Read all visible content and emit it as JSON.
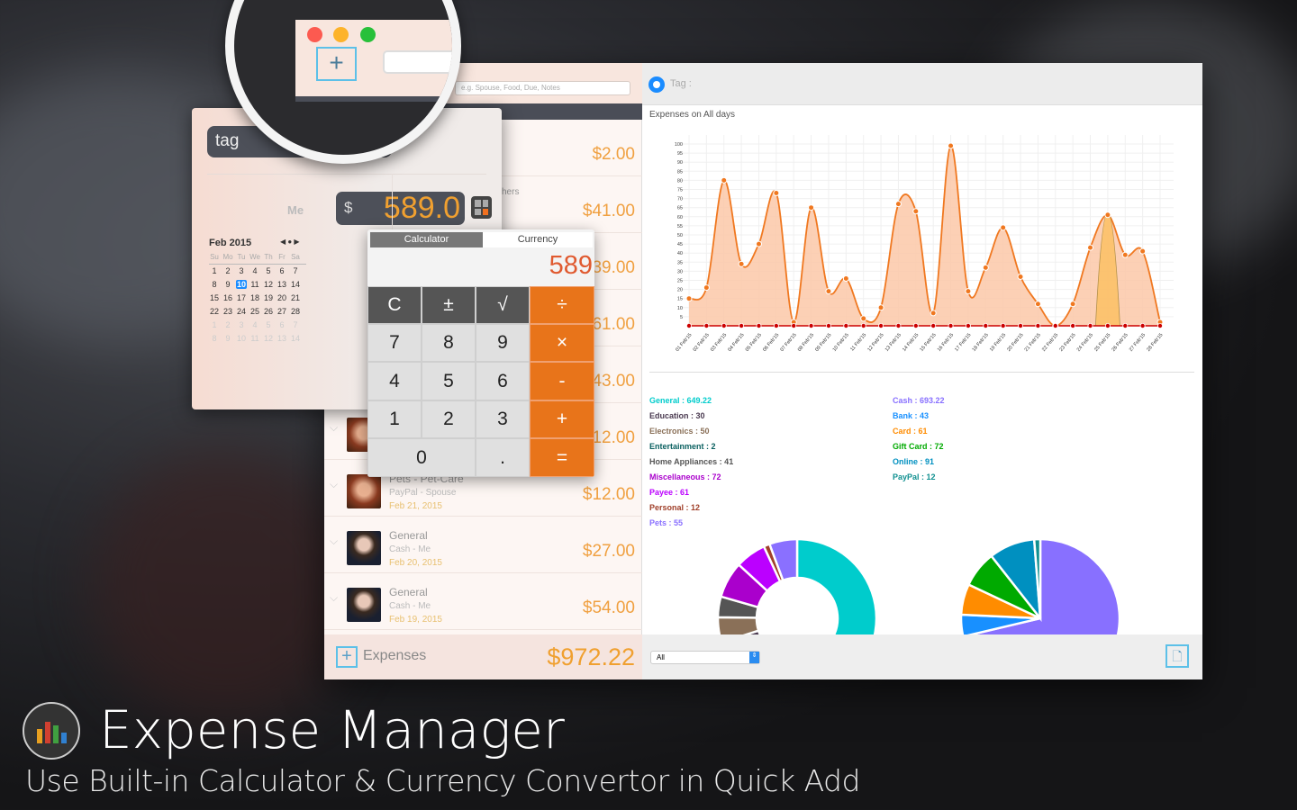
{
  "window": {
    "search_placeholder": "e.g. Spouse, Food, Due, Notes",
    "tag_label": "Tag :",
    "footer_label": "Expenses",
    "footer_total": "$972.22",
    "filter_value": "All"
  },
  "list": [
    {
      "amount": "$2.00"
    },
    {
      "subtitle": "hers",
      "amount": "$41.00"
    },
    {
      "amount": "$39.00"
    },
    {
      "amount": "$61.00"
    },
    {
      "amount": "$43.00"
    },
    {
      "amount": "$12.00",
      "avatar": "female"
    },
    {
      "title": "Pets - Pet-Care",
      "subtitle": "PayPal - Spouse",
      "date": "Feb 21, 2015",
      "amount": "$12.00",
      "avatar": "female"
    },
    {
      "title": "General",
      "subtitle": "Cash - Me",
      "date": "Feb 20, 2015",
      "amount": "$27.00",
      "avatar": "male"
    },
    {
      "title": "General",
      "subtitle": "Cash - Me",
      "date": "Feb 19, 2015",
      "amount": "$54.00",
      "avatar": "male"
    }
  ],
  "quick_add": {
    "tag": "tag",
    "payee": "Me",
    "currency_symbol": "$",
    "amount": "589.0",
    "calendar": {
      "month": "Feb 2015",
      "weekdays": [
        "Su",
        "Mo",
        "Tu",
        "We",
        "Th",
        "Fr",
        "Sa"
      ],
      "days": [
        [
          "1",
          "2",
          "3",
          "4",
          "5",
          "6",
          "7"
        ],
        [
          "8",
          "9",
          "10",
          "11",
          "12",
          "13",
          "14"
        ],
        [
          "15",
          "16",
          "17",
          "18",
          "19",
          "20",
          "21"
        ],
        [
          "22",
          "23",
          "24",
          "25",
          "26",
          "27",
          "28"
        ],
        [
          "1",
          "2",
          "3",
          "4",
          "5",
          "6",
          "7"
        ],
        [
          "8",
          "9",
          "10",
          "11",
          "12",
          "13",
          "14"
        ]
      ],
      "selected": "10"
    }
  },
  "calculator": {
    "tabs": [
      "Calculator",
      "Currency"
    ],
    "active_tab": "Calculator",
    "display": "589",
    "keys": [
      [
        "C",
        "±",
        "√",
        "÷"
      ],
      [
        "7",
        "8",
        "9",
        "×"
      ],
      [
        "4",
        "5",
        "6",
        "-"
      ],
      [
        "1",
        "2",
        "3",
        "+"
      ],
      [
        "0",
        ".",
        "="
      ]
    ]
  },
  "chart_data": [
    {
      "type": "area",
      "title": "Expenses on All days",
      "x": [
        "01 Feb'15",
        "02 Feb'15",
        "03 Feb'15",
        "04 Feb'15",
        "05 Feb'15",
        "06 Feb'15",
        "07 Feb'15",
        "08 Feb'15",
        "09 Feb'15",
        "10 Feb'15",
        "11 Feb'15",
        "12 Feb'15",
        "13 Feb'15",
        "14 Feb'15",
        "15 Feb'15",
        "16 Feb'15",
        "17 Feb'15",
        "18 Feb'15",
        "19 Feb'15",
        "20 Feb'15",
        "21 Feb'15",
        "22 Feb'15",
        "23 Feb'15",
        "24 Feb'15",
        "25 Feb'15",
        "26 Feb'15",
        "27 Feb'15",
        "28 Feb'15"
      ],
      "series": [
        {
          "values": [
            15,
            21,
            80,
            34,
            45,
            73,
            2,
            65,
            19,
            26,
            4,
            10,
            67,
            63,
            7,
            99,
            19,
            32,
            54,
            27,
            12,
            0,
            12,
            43,
            61,
            39,
            41,
            2
          ],
          "color": "#f07820"
        },
        {
          "values": [
            0,
            0,
            0,
            0,
            0,
            0,
            0,
            0,
            0,
            0,
            0,
            0,
            0,
            0,
            0,
            0,
            0,
            0,
            0,
            0,
            0,
            0,
            0,
            0,
            0,
            0,
            0,
            0
          ],
          "color": "#cc0000"
        }
      ],
      "yticks": [
        5,
        10,
        15,
        20,
        25,
        30,
        35,
        40,
        45,
        50,
        55,
        60,
        65,
        70,
        75,
        80,
        85,
        90,
        95,
        100
      ],
      "ylim": [
        0,
        100
      ],
      "grid": true
    },
    {
      "type": "donut",
      "slices": [
        {
          "label": "General",
          "value": 649.22,
          "color": "#00cccc"
        },
        {
          "label": "Entertainment",
          "value": 2,
          "color": "#0a6060"
        },
        {
          "label": "Education",
          "value": 30,
          "color": "#4a3a50"
        },
        {
          "label": "Electronics",
          "value": 50,
          "color": "#8a7058"
        },
        {
          "label": "Home Appliances",
          "value": 41,
          "color": "#555555"
        },
        {
          "label": "Miscellaneous",
          "value": 72,
          "color": "#aa00cc"
        },
        {
          "label": "Payee",
          "value": 61,
          "color": "#bb00ff"
        },
        {
          "label": "Personal",
          "value": 12,
          "color": "#a0402a"
        },
        {
          "label": "Pets",
          "value": 55,
          "color": "#8a70ff"
        }
      ],
      "legend_order": [
        0,
        2,
        3,
        1,
        4,
        5,
        6,
        7,
        8
      ]
    },
    {
      "type": "pie",
      "slices": [
        {
          "label": "Cash",
          "value": 693.22,
          "color": "#8870ff"
        },
        {
          "label": "Bank",
          "value": 43,
          "color": "#1890ff"
        },
        {
          "label": "Card",
          "value": 61,
          "color": "#ff8c00"
        },
        {
          "label": "Gift Card",
          "value": 72,
          "color": "#00aa00"
        },
        {
          "label": "Online",
          "value": 91,
          "color": "#0090c0"
        },
        {
          "label": "PayPal",
          "value": 12,
          "color": "#109090"
        }
      ]
    }
  ],
  "promo": {
    "title": "Expense Manager",
    "subtitle": "Use Built-in Calculator & Currency Convertor in Quick Add"
  }
}
